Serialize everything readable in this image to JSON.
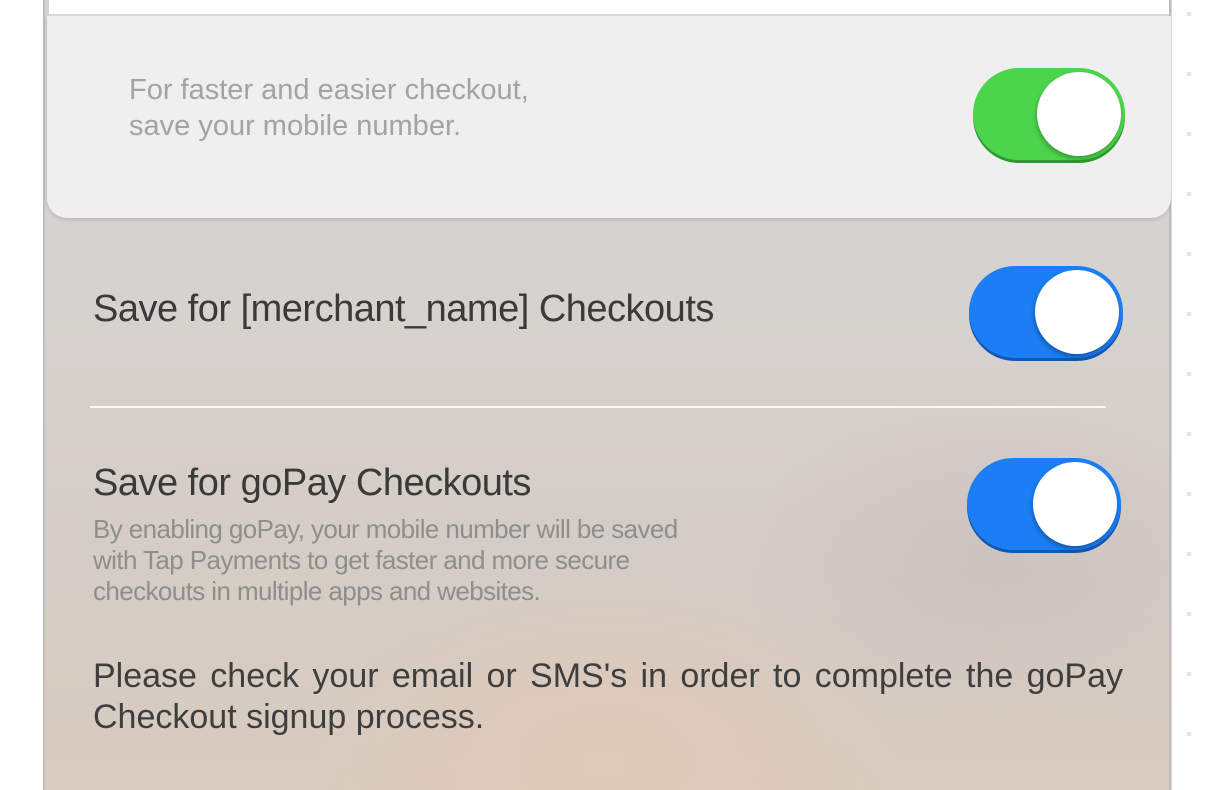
{
  "card": {
    "message_line1": "For faster and easier checkout,",
    "message_line2": "save your mobile number.",
    "save_number_toggle": {
      "state": "on",
      "color": "#4cd44c"
    }
  },
  "options": {
    "merchant": {
      "label": "Save for [merchant_name] Checkouts",
      "toggle": {
        "state": "on",
        "color": "#1b7ef5"
      }
    },
    "gopay": {
      "label": "Save for goPay Checkouts",
      "description_line1": "By enabling goPay, your mobile number will be saved",
      "description_line2": "with Tap Payments to get faster and more secure",
      "description_line3": "checkouts in multiple apps and websites.",
      "toggle": {
        "state": "on",
        "color": "#1b7ef5"
      }
    }
  },
  "notice": {
    "text": "Please check your email or SMS's in order to complete the goPay Checkout signup process."
  }
}
